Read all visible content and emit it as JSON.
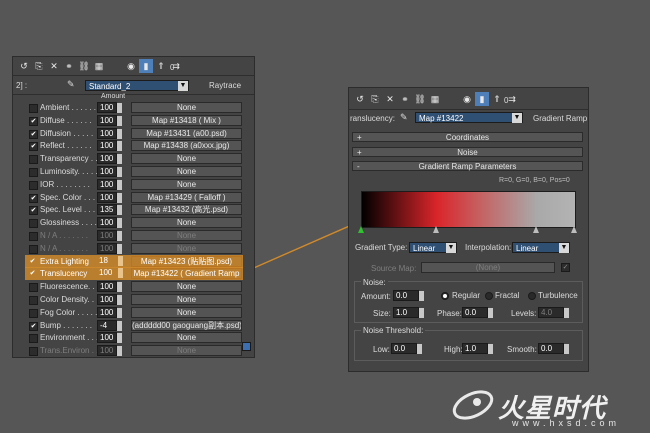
{
  "colors": {
    "highlight": "#cf8a2a",
    "dropdown": "#2f4f73",
    "panel": "#444444",
    "background": "#565656",
    "leader_line": "#d18a2a"
  },
  "left_panel": {
    "toolbar_icons": [
      "pick-material-icon",
      "put-to-scene-icon",
      "reset-icon",
      "make-unique-icon",
      "put-to-library-icon",
      "material-id-icon",
      "show-in-viewport-icon",
      "show-end-result-icon",
      "go-to-parent-icon",
      "go-forward-icon"
    ],
    "material_id_label": "0",
    "slot_label": "2] :",
    "material_name": "Standard_2",
    "material_type": "Raytrace",
    "column_header": "Amount",
    "rows": [
      {
        "label": "Ambient . . . . . .",
        "checked": false,
        "amount": "100",
        "map": "None",
        "dim": false,
        "highlight": false
      },
      {
        "label": "Diffuse . . . . . .",
        "checked": true,
        "amount": "100",
        "map": "Map #13418  ( Mix )",
        "dim": false,
        "highlight": false
      },
      {
        "label": "Diffusion . . . . .",
        "checked": true,
        "amount": "100",
        "map": "Map #13431 (a00.psd)",
        "dim": false,
        "highlight": false
      },
      {
        "label": "Reflect . . . . . .",
        "checked": true,
        "amount": "100",
        "map": "Map #13438 (a0xxx.jpg)",
        "dim": false,
        "highlight": false
      },
      {
        "label": "Transparency . . .",
        "checked": false,
        "amount": "100",
        "map": "None",
        "dim": false,
        "highlight": false
      },
      {
        "label": "Luminosity. . . . .",
        "checked": false,
        "amount": "100",
        "map": "None",
        "dim": false,
        "highlight": false
      },
      {
        "label": "IOR . . . . . . . .",
        "checked": false,
        "amount": "100",
        "map": "None",
        "dim": false,
        "highlight": false
      },
      {
        "label": "Spec. Color . . . .",
        "checked": true,
        "amount": "100",
        "map": "Map #13429  ( Falloff )",
        "dim": false,
        "highlight": false
      },
      {
        "label": "Spec. Level . . . .",
        "checked": true,
        "amount": "135",
        "map": "Map #13432 (高光.psd)",
        "dim": false,
        "highlight": false
      },
      {
        "label": "Glossiness . . . .",
        "checked": false,
        "amount": "100",
        "map": "None",
        "dim": false,
        "highlight": false
      },
      {
        "label": "N / A . . . . . . .",
        "checked": false,
        "amount": "100",
        "map": "None",
        "dim": true,
        "highlight": false
      },
      {
        "label": "N / A . . . . . . .",
        "checked": false,
        "amount": "100",
        "map": "None",
        "dim": true,
        "highlight": false
      },
      {
        "label": "Extra Lighting",
        "checked": true,
        "amount": "18",
        "map": "Map #13423 (贴贴图.psd)",
        "dim": false,
        "highlight": true
      },
      {
        "label": "Translucency",
        "checked": true,
        "amount": "100",
        "map": "Map #13422  ( Gradient Ramp",
        "dim": false,
        "highlight": true
      },
      {
        "label": "Fluorescence. . . .",
        "checked": false,
        "amount": "100",
        "map": "None",
        "dim": false,
        "highlight": false
      },
      {
        "label": "Color Density. . .",
        "checked": false,
        "amount": "100",
        "map": "None",
        "dim": false,
        "highlight": false
      },
      {
        "label": "Fog Color . . . . .",
        "checked": false,
        "amount": "100",
        "map": "None",
        "dim": false,
        "highlight": false
      },
      {
        "label": "Bump . . . . . . .",
        "checked": true,
        "amount": "-4",
        "map": "(addddd00 gaoguang副本.psd)",
        "dim": false,
        "highlight": false
      },
      {
        "label": "Environment . . . .",
        "checked": false,
        "amount": "100",
        "map": "None",
        "dim": false,
        "highlight": false
      },
      {
        "label": "Trans.Environ . . .",
        "checked": false,
        "amount": "100",
        "map": "None",
        "dim": true,
        "highlight": false
      }
    ]
  },
  "right_panel": {
    "toolbar_icons": [
      "pick-material-icon",
      "put-to-scene-icon",
      "reset-icon",
      "make-unique-icon",
      "put-to-library-icon",
      "material-id-icon",
      "show-in-viewport-icon",
      "show-end-result-icon",
      "go-to-parent-icon",
      "go-forward-icon"
    ],
    "material_id_label": "0",
    "slot_label": "ranslucency:",
    "map_name": "Map #13422",
    "map_type": "Gradient Ramp",
    "rollouts": [
      {
        "sign": "+",
        "title": "Coordinates"
      },
      {
        "sign": "+",
        "title": "Noise"
      },
      {
        "sign": "-",
        "title": "Gradient Ramp Parameters"
      }
    ],
    "rgb_readout": "R=0, G=0, B=0,   Pos=0",
    "gradient": {
      "stops": [
        {
          "pos": 0,
          "color": "#000000"
        },
        {
          "pos": 0.35,
          "color": "#d9252a"
        },
        {
          "pos": 0.55,
          "color": "#c56060"
        },
        {
          "pos": 0.82,
          "color": "#a9a9a9"
        },
        {
          "pos": 1,
          "color": "#b3b3b3"
        }
      ],
      "flags": [
        0,
        0.35,
        0.82,
        1
      ]
    },
    "gradient_type_label": "Gradient Type:",
    "gradient_type": "Linear",
    "interpolation_label": "Interpolation:",
    "interpolation": "Linear",
    "source_map_label": "Source Map:",
    "source_map_value": "(None)",
    "noise_group": "Noise:",
    "amount_label": "Amount:",
    "amount_value": "0.0",
    "regular_label": "Regular",
    "fractal_label": "Fractal",
    "turbulence_label": "Turbulence",
    "noise_mode": "Regular",
    "size_label": "Size:",
    "size_value": "1.0",
    "phase_label": "Phase:",
    "phase_value": "0.0",
    "levels_label": "Levels:",
    "levels_value": "4.0",
    "threshold_group": "Noise Threshold:",
    "low_label": "Low:",
    "low_value": "0.0",
    "high_label": "High:",
    "high_value": "1.0",
    "smooth_label": "Smooth:",
    "smooth_value": "0.0"
  },
  "watermark": {
    "logo_text": "火星时代",
    "url": "www.hxsd.com"
  }
}
